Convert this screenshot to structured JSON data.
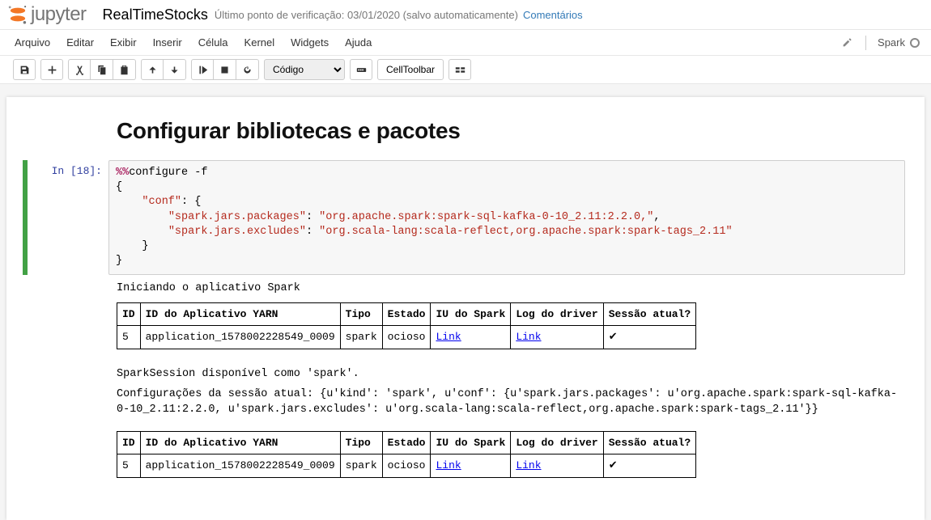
{
  "header": {
    "logo_text": "jupyter",
    "notebook_name": "RealTimeStocks",
    "checkpoint": "Último ponto de verificação: 03/01/2020 (salvo automaticamente)",
    "comments": "Comentários"
  },
  "menubar": {
    "items": [
      "Arquivo",
      "Editar",
      "Exibir",
      "Inserir",
      "Célula",
      "Kernel",
      "Widgets",
      "Ajuda"
    ],
    "kernel_name": "Spark"
  },
  "toolbar": {
    "cell_type": "Código",
    "cell_toolbar": "CellToolbar"
  },
  "markdown": {
    "heading": "Configurar bibliotecas e pacotes"
  },
  "code": {
    "prompt": "In [18]:",
    "lines": {
      "l1_magic": "%%",
      "l1_rest": "configure -f",
      "l2": "{",
      "l3_pre": "    ",
      "l3_key": "\"conf\"",
      "l3_post": ": {",
      "l4_pre": "        ",
      "l4_key": "\"spark.jars.packages\"",
      "l4_mid": ": ",
      "l4_val": "\"org.apache.spark:spark-sql-kafka-0-10_2.11:2.2.0,\"",
      "l4_post": ",",
      "l5_pre": "        ",
      "l5_key": "\"spark.jars.excludes\"",
      "l5_mid": ": ",
      "l5_val": "\"org.scala-lang:scala-reflect,org.apache.spark:spark-tags_2.11\"",
      "l6": "    }",
      "l7": "}"
    }
  },
  "output": {
    "starting": "Iniciando o aplicativo Spark",
    "table_headers": [
      "ID",
      "ID do Aplicativo YARN",
      "Tipo",
      "Estado",
      "IU do Spark",
      "Log do driver",
      "Sessão atual?"
    ],
    "row": {
      "id": "5",
      "app_id": "application_1578002228549_0009",
      "type": "spark",
      "state": "ocioso",
      "spark_ui": "Link",
      "driver_log": "Link",
      "current": "✔"
    },
    "session_available": "SparkSession disponível como 'spark'.",
    "config_prefix": "Configurações da sessão atual:",
    "config_dict": "{u'kind': 'spark', u'conf': {u'spark.jars.packages': u'org.apache.spark:spark-sql-kafka-0-10_2.11:2.2.0,",
    "config_dict2": "u'spark.jars.excludes': u'org.scala-lang:scala-reflect,org.apache.spark:spark-tags_2.11'}}"
  }
}
